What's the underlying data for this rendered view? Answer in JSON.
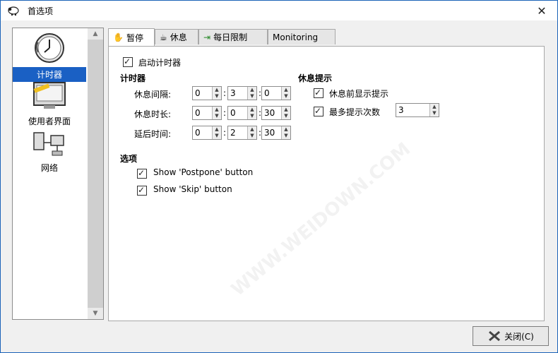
{
  "window": {
    "title": "首选项",
    "close_glyph": "✕"
  },
  "sidebar": {
    "items": [
      {
        "label": "计时器",
        "icon": "clock-icon",
        "selected": true
      },
      {
        "label": "使用者界面",
        "icon": "monitor-icon",
        "selected": false
      },
      {
        "label": "网络",
        "icon": "network-icon",
        "selected": false
      }
    ]
  },
  "tabs": [
    {
      "label": "暂停",
      "icon": "hand-icon",
      "active": true
    },
    {
      "label": "休息",
      "icon": "cup-icon",
      "active": false
    },
    {
      "label": "每日限制",
      "icon": "exit-icon",
      "active": false
    },
    {
      "label": "Monitoring",
      "icon": "",
      "active": false
    }
  ],
  "pause": {
    "enable_timer": {
      "label": "启动计时器",
      "checked": true
    },
    "timer_section": "计时器",
    "timers": [
      {
        "label": "休息间隔:",
        "h": "0",
        "m": "3",
        "s": "0"
      },
      {
        "label": "休息时长:",
        "h": "0",
        "m": "0",
        "s": "30"
      },
      {
        "label": "延后时间:",
        "h": "0",
        "m": "2",
        "s": "30"
      }
    ],
    "reminder_section": "休息提示",
    "reminder_before": {
      "label": "休息前显示提示",
      "checked": true
    },
    "max_prompts": {
      "label": "最多提示次数",
      "checked": true,
      "value": "3"
    },
    "options_section": "选项",
    "options": [
      {
        "label": "Show 'Postpone' button",
        "checked": true
      },
      {
        "label": "Show 'Skip' button",
        "checked": true
      }
    ]
  },
  "footer": {
    "close_label": "关闭(C)"
  },
  "watermark": "WWW.WEIDOWN.COM"
}
